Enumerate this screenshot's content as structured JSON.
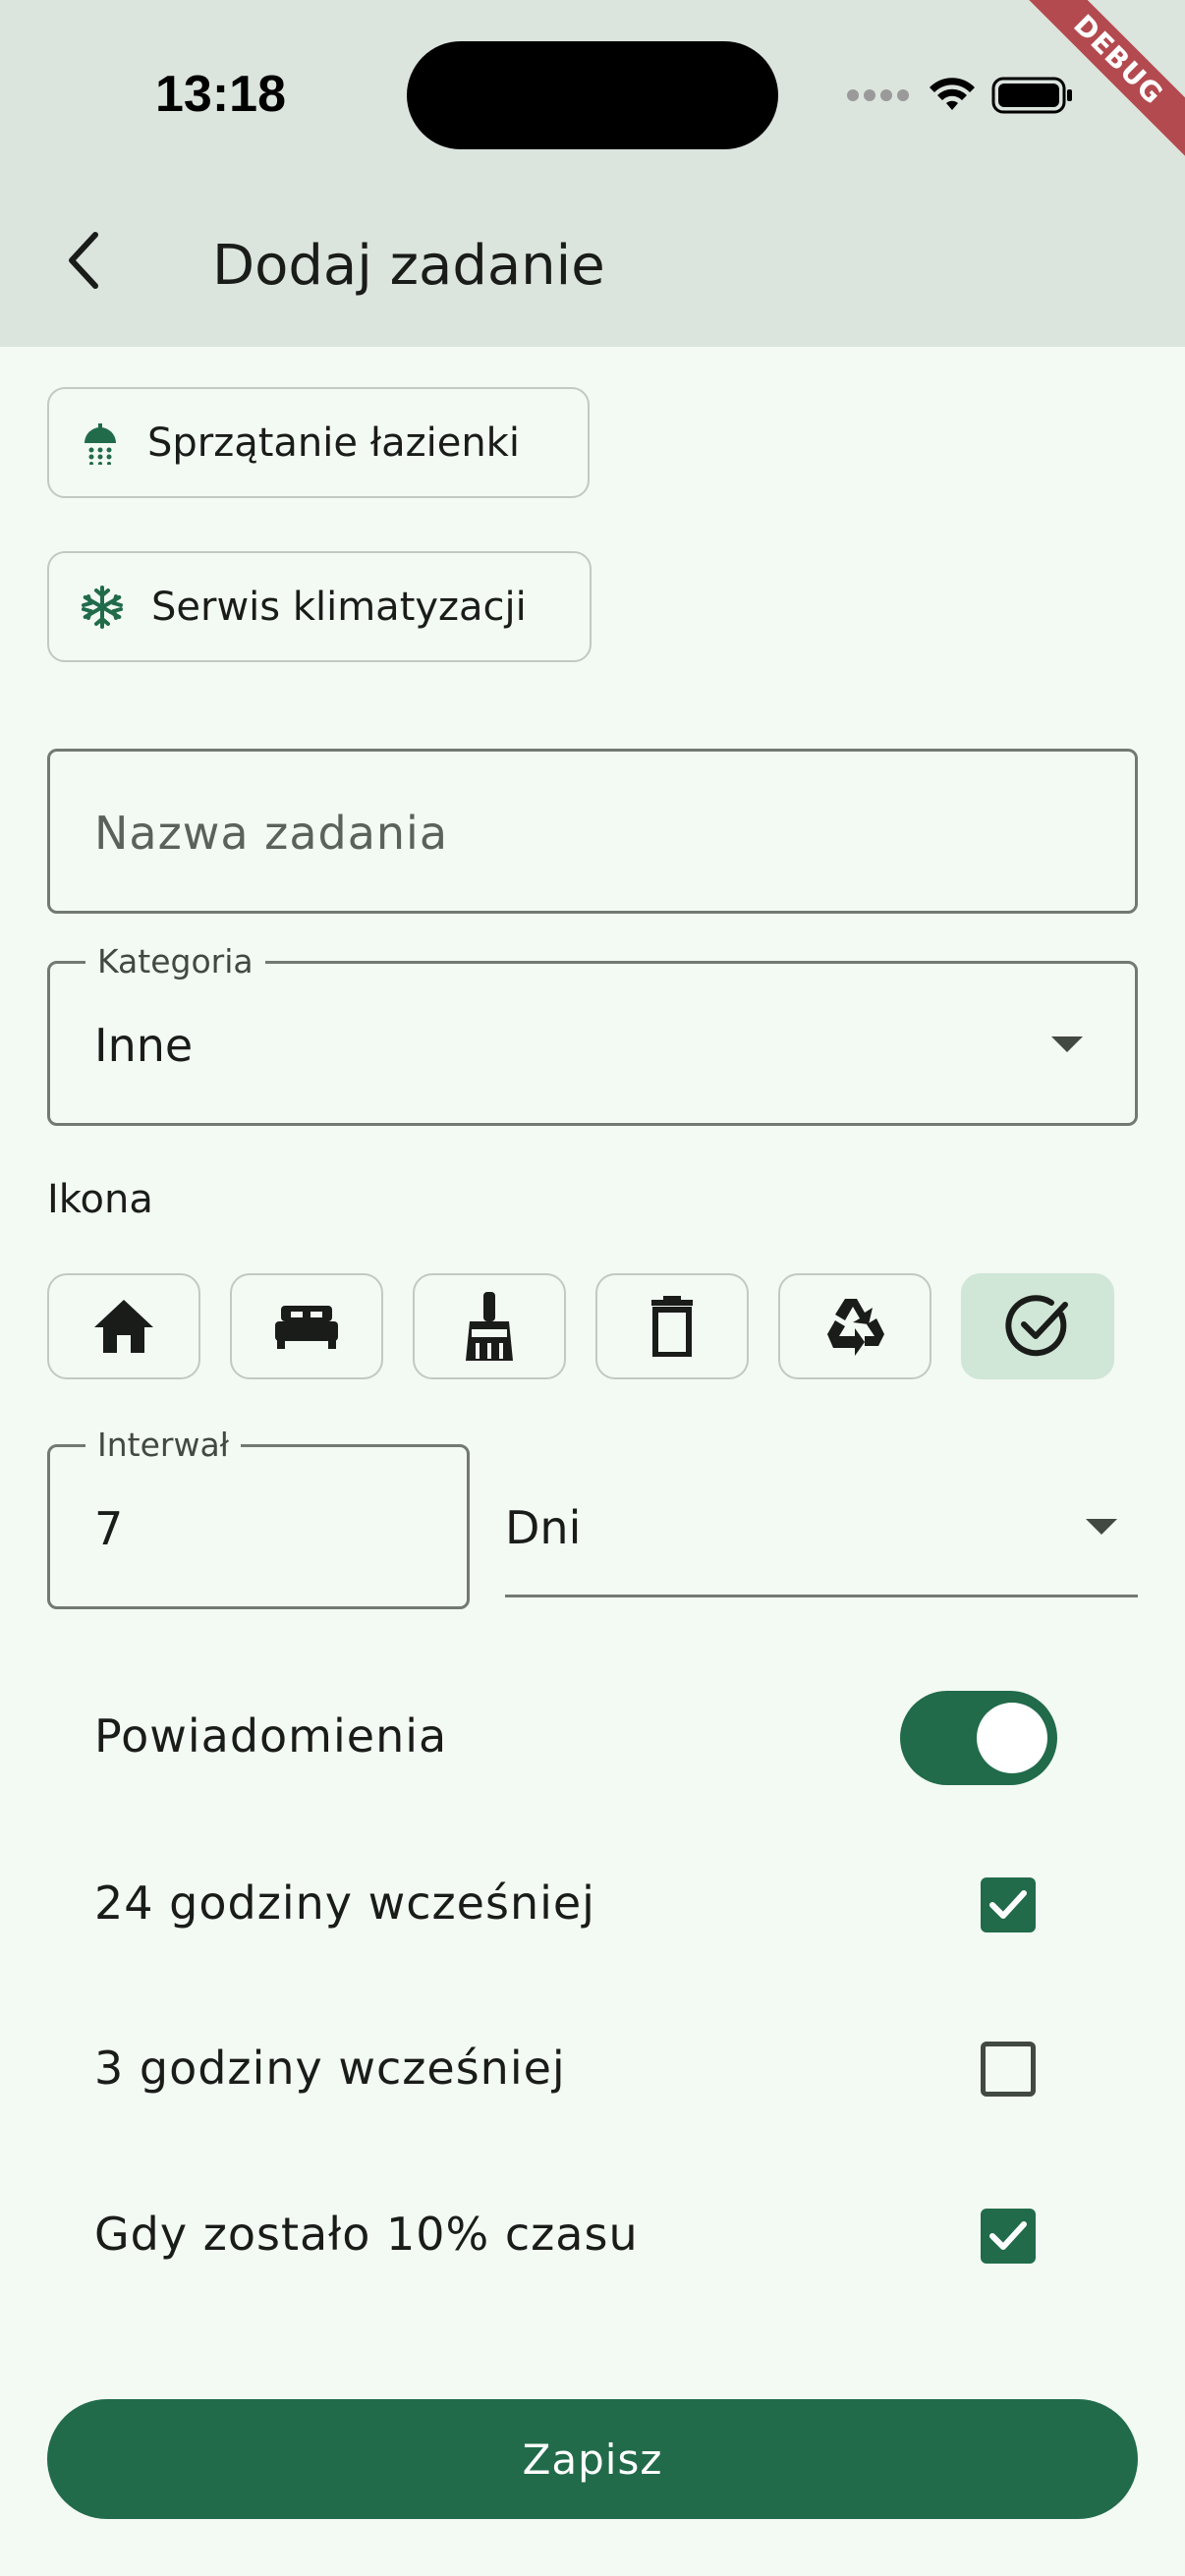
{
  "status_bar": {
    "time": "13:18",
    "debug_banner": "DEBUG"
  },
  "app_bar": {
    "title": "Dodaj zadanie",
    "back_icon": "chevron-left-icon"
  },
  "suggestions": [
    {
      "label": "Sprzątanie łazienki",
      "icon": "shower-icon"
    },
    {
      "label": "Serwis klimatyzacji",
      "icon": "snowflake-icon"
    }
  ],
  "form": {
    "name_placeholder": "Nazwa zadania",
    "category": {
      "label": "Kategoria",
      "value": "Inne"
    },
    "icon_section_label": "Ikona",
    "icons": [
      {
        "name": "home-icon",
        "selected": false
      },
      {
        "name": "bed-icon",
        "selected": false
      },
      {
        "name": "broom-icon",
        "selected": false
      },
      {
        "name": "trash-icon",
        "selected": false
      },
      {
        "name": "recycle-icon",
        "selected": false
      },
      {
        "name": "check-circle-icon",
        "selected": true
      }
    ],
    "interval": {
      "label": "Interwał",
      "value": "7",
      "unit": "Dni"
    },
    "notifications": {
      "label": "Powiadomienia",
      "enabled": true
    },
    "reminders": [
      {
        "label": "24 godziny wcześniej",
        "checked": true
      },
      {
        "label": "3 godziny wcześniej",
        "checked": false
      },
      {
        "label": "Gdy zostało 10% czasu",
        "checked": true
      }
    ]
  },
  "save_label": "Zapisz",
  "colors": {
    "primary": "#216b4a",
    "app_bar_bg": "#dbe4dd",
    "page_bg": "#f3f9f3",
    "selected_icon_bg": "#d0e6d6"
  }
}
